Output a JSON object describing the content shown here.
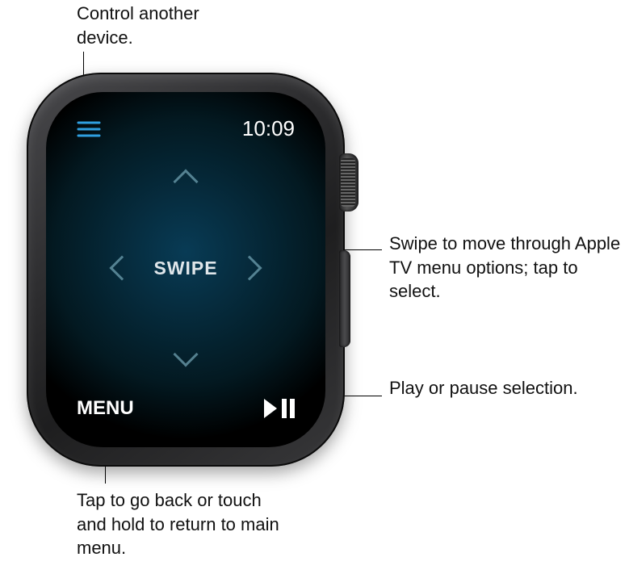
{
  "callouts": {
    "control_device": "Control another device.",
    "swipe": "Swipe to move through Apple TV menu options; tap to select.",
    "play_pause": "Play or pause selection.",
    "menu": "Tap to go back or touch and hold to return to main menu."
  },
  "status_bar": {
    "time": "10:09",
    "list_icon_name": "list-icon"
  },
  "remote": {
    "swipe_label": "SWIPE",
    "menu_label": "MENU",
    "play_pause_icon_name": "play-pause-icon"
  }
}
